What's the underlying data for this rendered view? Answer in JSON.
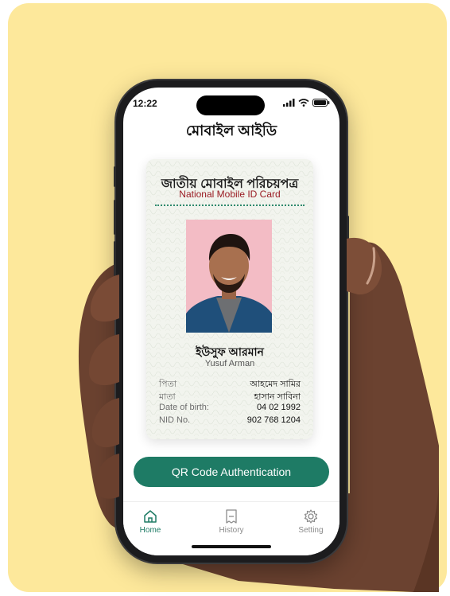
{
  "status": {
    "time": "12:22"
  },
  "app": {
    "title": "মোবাইল আইডি"
  },
  "card": {
    "title_bn": "জাতীয় মোবাইল পরিচয়পত্র",
    "title_en": "National Mobile ID Card",
    "name_bn": "ইউসুফ আরমান",
    "name_en": "Yusuf Arman",
    "fields": [
      {
        "label": "পিতা",
        "value": "আহমেদ সামির"
      },
      {
        "label": "মাতা",
        "value": "হাসান সাবিনা"
      },
      {
        "label": "Date of birth:",
        "value": "04 02 1992"
      },
      {
        "label": "NID No.",
        "value": "902 768 1204"
      }
    ]
  },
  "actions": {
    "qr_label": "QR Code Authentication"
  },
  "tabs": [
    {
      "label": "Home",
      "icon": "home-icon",
      "active": true
    },
    {
      "label": "History",
      "icon": "history-icon",
      "active": false
    },
    {
      "label": "Setting",
      "icon": "gear-icon",
      "active": false
    }
  ],
  "colors": {
    "background": "#fde89b",
    "accent": "#1e7b65",
    "card_subtitle": "#9b1c24",
    "photo_bg": "#f3bcc5"
  }
}
